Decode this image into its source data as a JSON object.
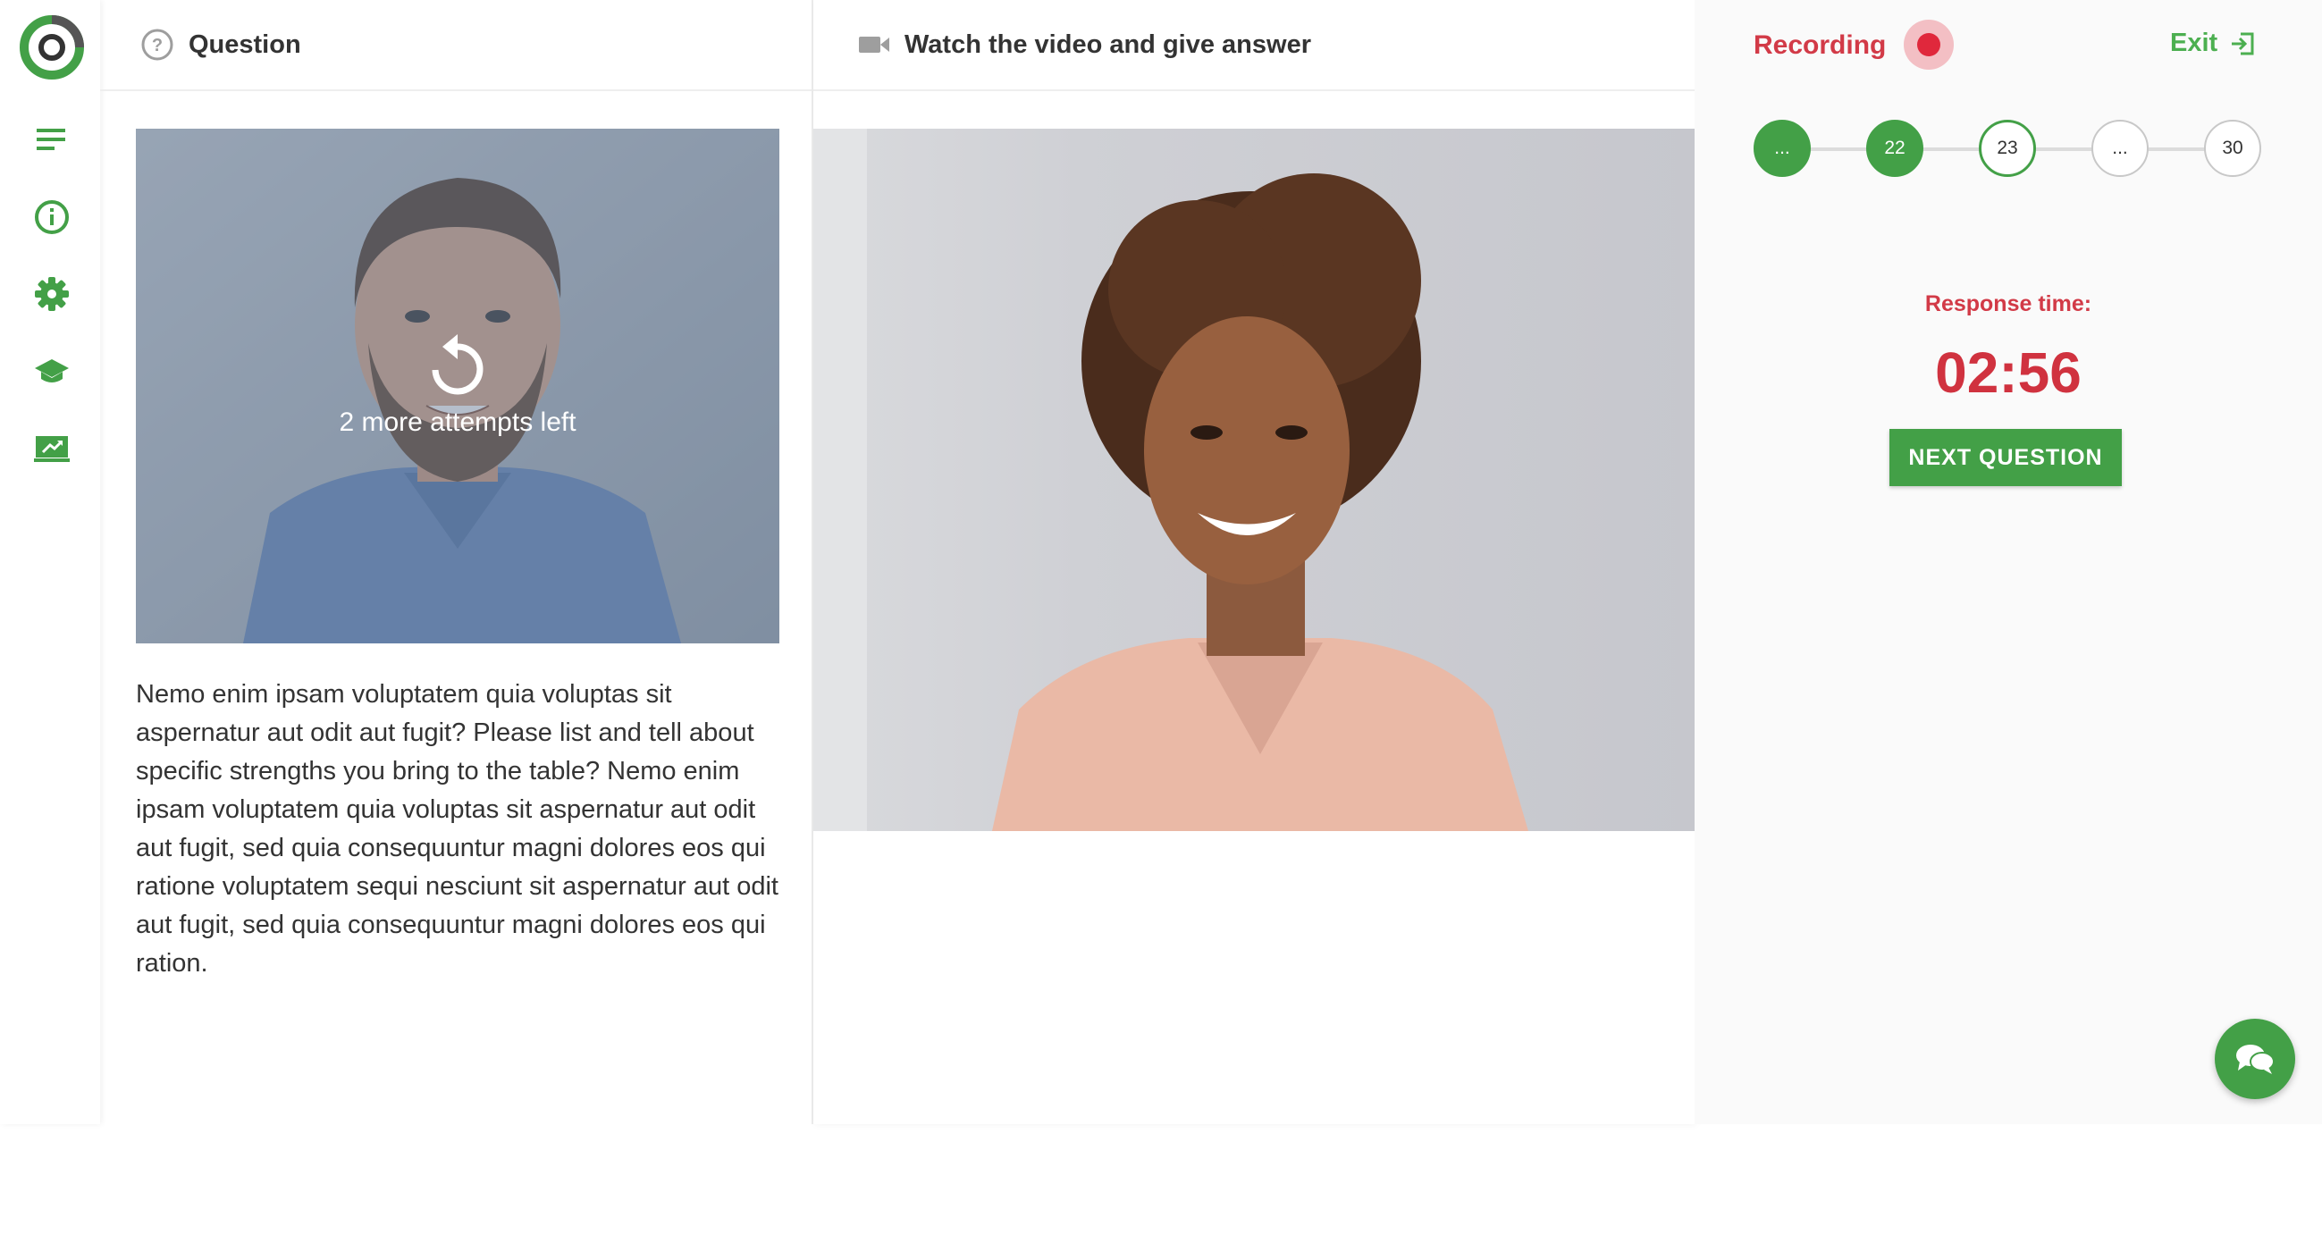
{
  "sidebar": {
    "logo": "ring-logo",
    "items": [
      {
        "icon": "menu-lines-icon"
      },
      {
        "icon": "info-icon"
      },
      {
        "icon": "gear-icon"
      },
      {
        "icon": "graduation-cap-icon"
      },
      {
        "icon": "presentation-icon"
      }
    ]
  },
  "question_panel": {
    "title": "Question",
    "icon": "question-circle-icon",
    "attempts_text": "2 more attempts left",
    "replay_icon": "replay-icon",
    "question_text": "Nemo enim ipsam voluptatem quia voluptas sit aspernatur aut odit aut fugit? Please list and tell about specific strengths you bring to the table? Nemo enim ipsam voluptatem quia voluptas sit aspernatur aut odit aut fugit, sed quia consequuntur magni dolores eos qui ratione voluptatem sequi nesciunt sit aspernatur aut odit aut fugit, sed quia consequuntur magni dolores eos qui ration."
  },
  "video_panel": {
    "title": "Watch the video and give answer",
    "icon": "video-camera-icon"
  },
  "right_panel": {
    "recording_label": "Recording",
    "exit_label": "Exit",
    "steps": [
      {
        "label": "...",
        "state": "done"
      },
      {
        "label": "22",
        "state": "done"
      },
      {
        "label": "23",
        "state": "current"
      },
      {
        "label": "...",
        "state": "todo"
      },
      {
        "label": "30",
        "state": "todo"
      }
    ],
    "response_time_label": "Response time:",
    "response_time_value": "02:56",
    "next_button": "NEXT QUESTION"
  },
  "colors": {
    "brand_green": "#43a047",
    "recording_red": "#d23a47"
  }
}
